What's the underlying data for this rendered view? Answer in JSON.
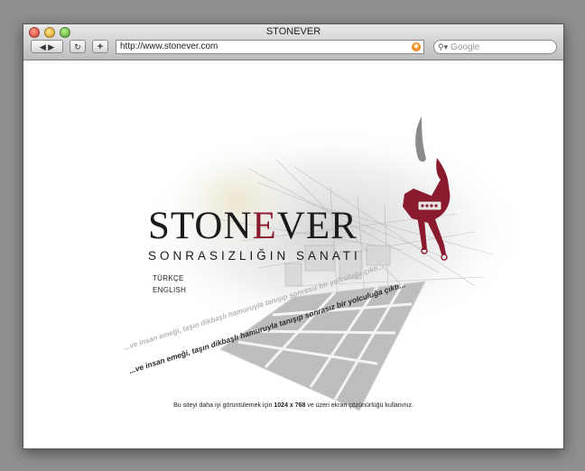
{
  "window": {
    "title": "STONEVER"
  },
  "toolbar": {
    "back_icon": "back-arrow-icon",
    "forward_icon": "forward-arrow-icon",
    "reload_icon": "reload-icon",
    "add_icon": "plus-icon",
    "url": "http://www.stonever.com",
    "search_placeholder": "Google"
  },
  "page": {
    "logo_part1": "STON",
    "logo_e": "E",
    "logo_part2": "VER",
    "tagline": "SONRASIZLIĞIN SANATI",
    "lang_tr": "TÜRKÇE",
    "lang_en": "ENGLISH",
    "slogan_main": "...ve insan emeği, taşın dikbaşlı hamuruyla tanışıp sonrasız bir yolculuğa çıktı...",
    "slogan_echo": "...ve insan emeği, taşın dikbaşlı hamuruyla tanışıp sonrasız bir yolculuğa çıktı...",
    "footnote_pre": "Bu siteyi daha iyi görüntülemek için",
    "footnote_res": "1024 x 768",
    "footnote_post": "ve üzeri ekran çözünürlüğü kullanınız."
  },
  "colors": {
    "brand_red": "#8a1a2e",
    "text_dark": "#1a1a1a"
  }
}
